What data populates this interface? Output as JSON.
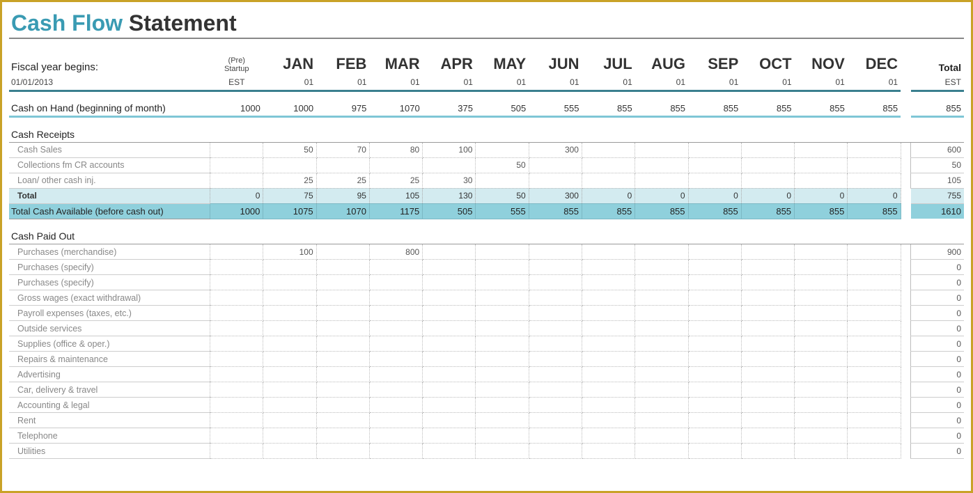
{
  "title": {
    "accent": "Cash Flow",
    "rest": " Statement"
  },
  "fiscal_label": "Fiscal year begins:",
  "fiscal_date": "01/01/2013",
  "pre_line1": "(Pre)",
  "pre_line2": "Startup",
  "pre_est": "EST",
  "months": [
    "JAN",
    "FEB",
    "MAR",
    "APR",
    "MAY",
    "JUN",
    "JUL",
    "AUG",
    "SEP",
    "OCT",
    "NOV",
    "DEC"
  ],
  "days": [
    "01",
    "01",
    "01",
    "01",
    "01",
    "01",
    "01",
    "01",
    "01",
    "01",
    "01",
    "01"
  ],
  "total_label": "Total",
  "total_est": "EST",
  "cash_on_hand": {
    "label": "Cash on Hand (beginning of month)",
    "pre": "1000",
    "vals": [
      "1000",
      "975",
      "1070",
      "375",
      "505",
      "555",
      "855",
      "855",
      "855",
      "855",
      "855",
      "855"
    ],
    "total": "855"
  },
  "receipts_header": "Cash Receipts",
  "receipts": [
    {
      "label": "Cash Sales",
      "pre": "",
      "vals": [
        "50",
        "70",
        "80",
        "100",
        "",
        "300",
        "",
        "",
        "",
        "",
        "",
        ""
      ],
      "total": "600"
    },
    {
      "label": "Collections fm CR accounts",
      "pre": "",
      "vals": [
        "",
        "",
        "",
        "",
        "50",
        "",
        "",
        "",
        "",
        "",
        "",
        ""
      ],
      "total": "50"
    },
    {
      "label": "Loan/ other cash inj.",
      "pre": "",
      "vals": [
        "25",
        "25",
        "25",
        "30",
        "",
        "",
        "",
        "",
        "",
        "",
        "",
        ""
      ],
      "total": "105"
    }
  ],
  "receipts_total": {
    "label": "Total",
    "pre": "0",
    "vals": [
      "75",
      "95",
      "105",
      "130",
      "50",
      "300",
      "0",
      "0",
      "0",
      "0",
      "0",
      "0"
    ],
    "total": "755"
  },
  "total_available": {
    "label": "Total Cash Available (before cash out)",
    "pre": "1000",
    "vals": [
      "1075",
      "1070",
      "1175",
      "505",
      "555",
      "855",
      "855",
      "855",
      "855",
      "855",
      "855",
      "855"
    ],
    "total": "1610"
  },
  "paidout_header": "Cash Paid Out",
  "paidout": [
    {
      "label": "Purchases (merchandise)",
      "pre": "",
      "vals": [
        "100",
        "",
        "800",
        "",
        "",
        "",
        "",
        "",
        "",
        "",
        "",
        ""
      ],
      "total": "900"
    },
    {
      "label": "Purchases (specify)",
      "pre": "",
      "vals": [
        "",
        "",
        "",
        "",
        "",
        "",
        "",
        "",
        "",
        "",
        "",
        ""
      ],
      "total": "0"
    },
    {
      "label": "Purchases (specify)",
      "pre": "",
      "vals": [
        "",
        "",
        "",
        "",
        "",
        "",
        "",
        "",
        "",
        "",
        "",
        ""
      ],
      "total": "0"
    },
    {
      "label": "Gross wages (exact withdrawal)",
      "pre": "",
      "vals": [
        "",
        "",
        "",
        "",
        "",
        "",
        "",
        "",
        "",
        "",
        "",
        ""
      ],
      "total": "0"
    },
    {
      "label": "Payroll expenses (taxes, etc.)",
      "pre": "",
      "vals": [
        "",
        "",
        "",
        "",
        "",
        "",
        "",
        "",
        "",
        "",
        "",
        ""
      ],
      "total": "0"
    },
    {
      "label": "Outside services",
      "pre": "",
      "vals": [
        "",
        "",
        "",
        "",
        "",
        "",
        "",
        "",
        "",
        "",
        "",
        ""
      ],
      "total": "0"
    },
    {
      "label": "Supplies (office & oper.)",
      "pre": "",
      "vals": [
        "",
        "",
        "",
        "",
        "",
        "",
        "",
        "",
        "",
        "",
        "",
        ""
      ],
      "total": "0"
    },
    {
      "label": "Repairs & maintenance",
      "pre": "",
      "vals": [
        "",
        "",
        "",
        "",
        "",
        "",
        "",
        "",
        "",
        "",
        "",
        ""
      ],
      "total": "0"
    },
    {
      "label": "Advertising",
      "pre": "",
      "vals": [
        "",
        "",
        "",
        "",
        "",
        "",
        "",
        "",
        "",
        "",
        "",
        ""
      ],
      "total": "0"
    },
    {
      "label": "Car, delivery & travel",
      "pre": "",
      "vals": [
        "",
        "",
        "",
        "",
        "",
        "",
        "",
        "",
        "",
        "",
        "",
        ""
      ],
      "total": "0"
    },
    {
      "label": "Accounting & legal",
      "pre": "",
      "vals": [
        "",
        "",
        "",
        "",
        "",
        "",
        "",
        "",
        "",
        "",
        "",
        ""
      ],
      "total": "0"
    },
    {
      "label": "Rent",
      "pre": "",
      "vals": [
        "",
        "",
        "",
        "",
        "",
        "",
        "",
        "",
        "",
        "",
        "",
        ""
      ],
      "total": "0"
    },
    {
      "label": "Telephone",
      "pre": "",
      "vals": [
        "",
        "",
        "",
        "",
        "",
        "",
        "",
        "",
        "",
        "",
        "",
        ""
      ],
      "total": "0"
    },
    {
      "label": "Utilities",
      "pre": "",
      "vals": [
        "",
        "",
        "",
        "",
        "",
        "",
        "",
        "",
        "",
        "",
        "",
        ""
      ],
      "total": "0"
    }
  ]
}
